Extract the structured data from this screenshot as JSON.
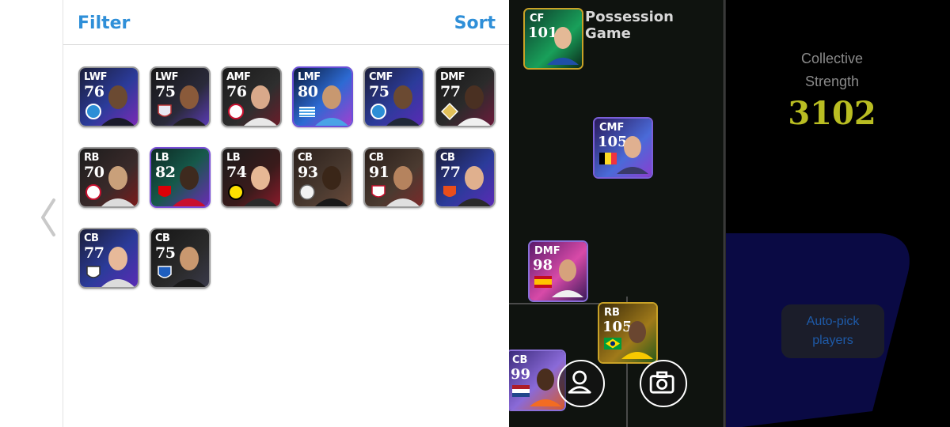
{
  "header": {
    "filter_label": "Filter",
    "sort_label": "Sort"
  },
  "player_cards": [
    {
      "position": "LWF",
      "rating": "76"
    },
    {
      "position": "LWF",
      "rating": "75"
    },
    {
      "position": "AMF",
      "rating": "76"
    },
    {
      "position": "LMF",
      "rating": "80"
    },
    {
      "position": "CMF",
      "rating": "75"
    },
    {
      "position": "DMF",
      "rating": "77"
    },
    {
      "position": "RB",
      "rating": "70"
    },
    {
      "position": "LB",
      "rating": "82"
    },
    {
      "position": "LB",
      "rating": "74"
    },
    {
      "position": "CB",
      "rating": "93"
    },
    {
      "position": "CB",
      "rating": "91"
    },
    {
      "position": "CB",
      "rating": "77"
    },
    {
      "position": "CB",
      "rating": "77"
    },
    {
      "position": "CB",
      "rating": "75"
    }
  ],
  "pitch": {
    "title": "Possession Game",
    "players": [
      {
        "position": "CF",
        "rating": "101"
      },
      {
        "position": "CMF",
        "rating": "105"
      },
      {
        "position": "DMF",
        "rating": "98"
      },
      {
        "position": "RB",
        "rating": "105"
      },
      {
        "position": "CB",
        "rating": "99"
      }
    ]
  },
  "team": {
    "collective_strength_line1": "Collective",
    "collective_strength_line2": "Strength",
    "collective_strength_value": "3102",
    "autopick_line1": "Auto-pick",
    "autopick_line2": "players"
  },
  "icons": {
    "back": "chevron-left-icon",
    "profile": "person-icon",
    "camera": "camera-icon"
  },
  "colors": {
    "accent": "#2f8fd8",
    "strength": "#b9bd22",
    "autopick_text": "#1e5aa8"
  }
}
